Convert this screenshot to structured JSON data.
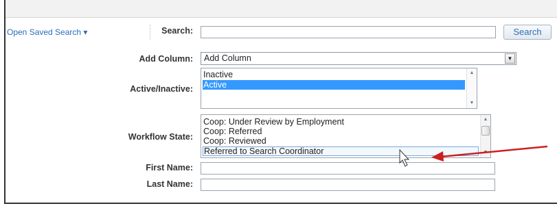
{
  "toolbar": {
    "open_saved_search": "Open Saved Search ▾",
    "search_label": "Search:",
    "search_value": "",
    "search_button": "Search"
  },
  "form": {
    "add_column_label": "Add Column:",
    "add_column_value": "Add Column",
    "active_inactive_label": "Active/Inactive:",
    "active_inactive_options": [
      "Inactive",
      "Active"
    ],
    "active_inactive_selected": "Active",
    "workflow_state_label": "Workflow State:",
    "workflow_state_options": [
      "Coop: Under Review by Employment",
      "Coop: Referred",
      "Coop: Reviewed",
      "Referred to Search Coordinator"
    ],
    "workflow_state_hovered": "Referred to Search Coordinator",
    "first_name_label": "First Name:",
    "first_name_value": "",
    "last_name_label": "Last Name:",
    "last_name_value": ""
  },
  "icons": {
    "dropdown": "chevron-down-icon",
    "scroll_up": "triangle-up-icon",
    "scroll_down": "triangle-down-icon",
    "cursor": "mouse-pointer-icon",
    "annotation": "red-arrow-icon"
  },
  "colors": {
    "link": "#2a6ebb",
    "selection": "#3399ff",
    "annotation_arrow": "#cc1f1f"
  }
}
